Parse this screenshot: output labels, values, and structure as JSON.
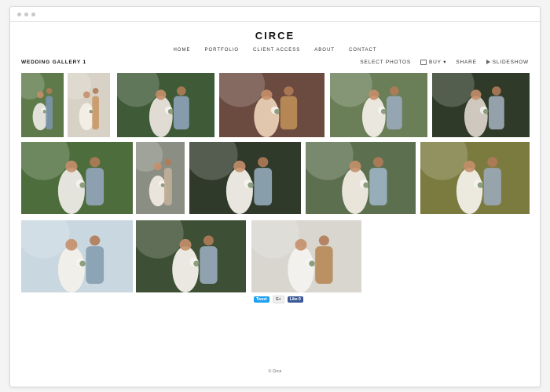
{
  "site": {
    "brand": "CIRCE"
  },
  "nav": {
    "items": [
      {
        "label": "HOME"
      },
      {
        "label": "PORTFOLIO"
      },
      {
        "label": "CLIENT ACCESS"
      },
      {
        "label": "ABOUT"
      },
      {
        "label": "CONTACT"
      }
    ]
  },
  "gallery": {
    "title": "WEDDING GALLERY 1",
    "actions": {
      "select_photos": "SELECT PHOTOS",
      "buy": "BUY ▾",
      "share": "SHARE",
      "slideshow": "SLIDESHOW"
    },
    "photos": [
      {
        "name": "photo-1",
        "bg": "#5f7a4a",
        "a": "#e8e6e0",
        "b": "#7a93a8"
      },
      {
        "name": "photo-2",
        "bg": "#d8d2c6",
        "a": "#f3efe8",
        "b": "#c99b6c"
      },
      {
        "name": "photo-3",
        "bg": "#3e5a36",
        "a": "#e9e4dc",
        "b": "#8aa0b4"
      },
      {
        "name": "photo-4",
        "bg": "#6b4a3f",
        "a": "#e9cdb5",
        "b": "#b98a55"
      },
      {
        "name": "photo-5",
        "bg": "#6a7f57",
        "a": "#f1ede6",
        "b": "#98a8b6"
      },
      {
        "name": "photo-6",
        "bg": "#2f3b28",
        "a": "#d7d0c6",
        "b": "#9aa6b1"
      },
      {
        "name": "photo-7",
        "bg": "#4e6d3c",
        "a": "#ecebe6",
        "b": "#8fa3b6"
      },
      {
        "name": "photo-8",
        "bg": "#8b8f83",
        "a": "#efe9e1",
        "b": "#bfae98"
      },
      {
        "name": "photo-9",
        "bg": "#2f3a2a",
        "a": "#f2efe9",
        "b": "#8ea3b2"
      },
      {
        "name": "photo-10",
        "bg": "#5c6f4f",
        "a": "#f0ebe3",
        "b": "#9bb0c0"
      },
      {
        "name": "photo-11",
        "bg": "#7b7a3f",
        "a": "#f2efe8",
        "b": "#9aa7b2"
      },
      {
        "name": "photo-12",
        "bg": "#c9d7e0",
        "a": "#f2f0ea",
        "b": "#8aa1b3"
      },
      {
        "name": "photo-13",
        "bg": "#3d4f34",
        "a": "#f3f0ea",
        "b": "#95a7b6"
      },
      {
        "name": "photo-14",
        "bg": "#d8d6cf",
        "a": "#f3f2ee",
        "b": "#b98d5e"
      }
    ]
  },
  "social": {
    "tweet": "Tweet",
    "gplus": "G+",
    "fb_like": "Like 0"
  },
  "footer": {
    "copyright": "© Circe"
  }
}
